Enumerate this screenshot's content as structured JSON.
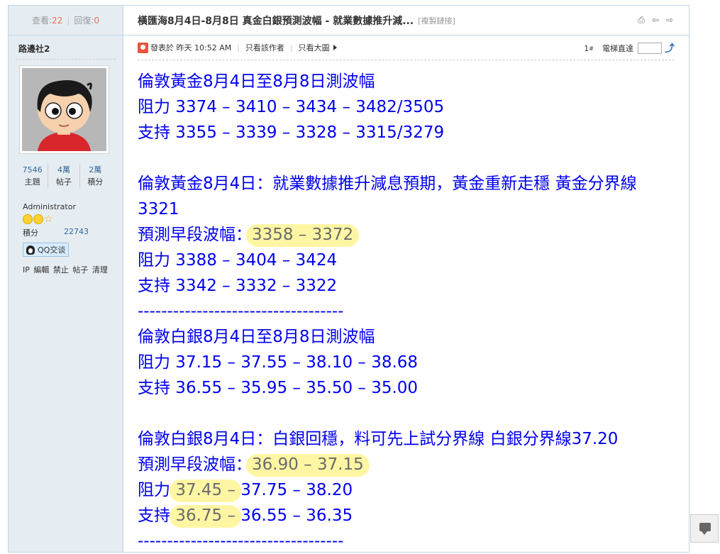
{
  "sidebar": {
    "views_label": "查看:",
    "views": "22",
    "replies_label": "回復:",
    "replies": "0",
    "author": "路邊社2",
    "stats": [
      {
        "value": "7546",
        "label": "主題"
      },
      {
        "value": "4萬",
        "label": "帖子"
      },
      {
        "value": "2萬",
        "label": "積分"
      }
    ],
    "role": "Administrator",
    "points_label": "積分",
    "points": "22743",
    "qq_label": "QQ交谈",
    "admin_links": "IP 編輯 禁止 帖子 清理"
  },
  "thread": {
    "title": "橫匯海8月4日-8月8日 真金白銀預測波幅 - 就業數據推升減...",
    "copy_link": "[複製鏈接]",
    "posted": "發表於 昨天 10:52 AM",
    "author_only": "只看該作者",
    "big_image": "只看大圖",
    "floor": "1",
    "floor_sup": "#",
    "elevator": "電梯直達"
  },
  "post": {
    "l1": "倫敦黃金8月4日至8月8日測波幅",
    "l2": "阻力 3374 – 3410 – 3434 – 3482/3505",
    "l3": "支持 3355 – 3339 – 3328 – 3315/3279",
    "l4": "倫敦黃金8月4日：就業數據推升減息預期，黃金重新走穩  黃金分界線3321",
    "l5_label": "預測早段波幅：",
    "l5_value": "3358 – 3372",
    "l6": "阻力 3388 – 3404 – 3424",
    "l7": "支持 3342 – 3332 – 3322",
    "divider": "-----------------------------------",
    "l8": "倫敦白銀8月4日至8月8日測波幅",
    "l9": "阻力 37.15 – 37.55 – 38.10 – 38.68",
    "l10": "支持 36.55 – 35.95 – 35.50 – 35.00",
    "l11": "倫敦白銀8月4日：白銀回穩，料可先上試分界線 白銀分界線37.20",
    "l12_label": "預測早段波幅：",
    "l12_value": "36.90 – 37.15",
    "l13_label": "阻力 ",
    "l13_hl": "37.45 –",
    "l13_rest": " 37.75 – 38.20",
    "l14_label": "支持 ",
    "l14_hl": "36.75 –",
    "l14_rest": " 36.55 – 36.35",
    "divider2": "-----------------------------------"
  },
  "colors": {
    "link_blue": "#0000ee",
    "highlight": "#fff59a",
    "sidebar_bg": "#e5edf2"
  }
}
